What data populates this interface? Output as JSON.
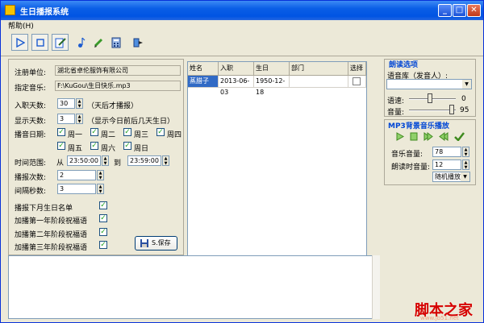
{
  "window": {
    "title": "生日播报系统",
    "minimize": "_",
    "maximize": "□",
    "close": "✕"
  },
  "menu": {
    "help": "帮助(H)"
  },
  "form": {
    "reg_unit_label": "注册单位:",
    "reg_unit_value": "湖北省卓伦服饰有限公司",
    "music_label": "指定音乐:",
    "music_value": "F:\\KuGou\\生日快乐.mp3",
    "entry_days_label": "入职天数:",
    "entry_days_value": "30",
    "entry_days_hint": "（天后才播报）",
    "display_days_label": "显示天数:",
    "display_days_value": "3",
    "display_days_hint": "（显示今日前后几天生日）",
    "play_date_label": "播音日期:",
    "weekdays": [
      "周一",
      "周二",
      "周三",
      "周四",
      "周五",
      "周六",
      "周日"
    ],
    "time_range_label": "时间范围:",
    "from_label": "从",
    "time_from": "23:50:00",
    "to_label": "到",
    "time_to": "23:59:00",
    "play_count_label": "播报次数:",
    "play_count_value": "2",
    "interval_label": "间隔秒数:",
    "interval_value": "3",
    "opt_next_month": "播报下月生日名单",
    "opt_year1": "加播第一年阶段祝福语",
    "opt_year2": "加播第二年阶段祝福语",
    "opt_year3": "加播第三年阶段祝福语",
    "save_label": "S.保存"
  },
  "table": {
    "columns": [
      "姓名",
      "入职",
      "生日",
      "部门",
      "选择"
    ],
    "rows": [
      {
        "name": "蒸腊子",
        "entry": "2013-06-03",
        "birthday": "1950-12-18",
        "dept": "",
        "select": ""
      }
    ]
  },
  "reading": {
    "section_title": "朗读选项",
    "voice_label": "语音库（发音人）:",
    "voice_value": "",
    "speed_label": "语速:",
    "speed_value": "0",
    "volume_label": "音量:",
    "volume_value": "95"
  },
  "bg_music": {
    "section_title": "MP3背景音乐播放",
    "music_volume_label": "音乐音量:",
    "music_volume_value": "78",
    "read_volume_label": "朗读时音量:",
    "read_volume_value": "12",
    "play_mode_value": "随机播放"
  },
  "watermark": {
    "text": "脚本之家",
    "sub": "www.jb51.net"
  }
}
